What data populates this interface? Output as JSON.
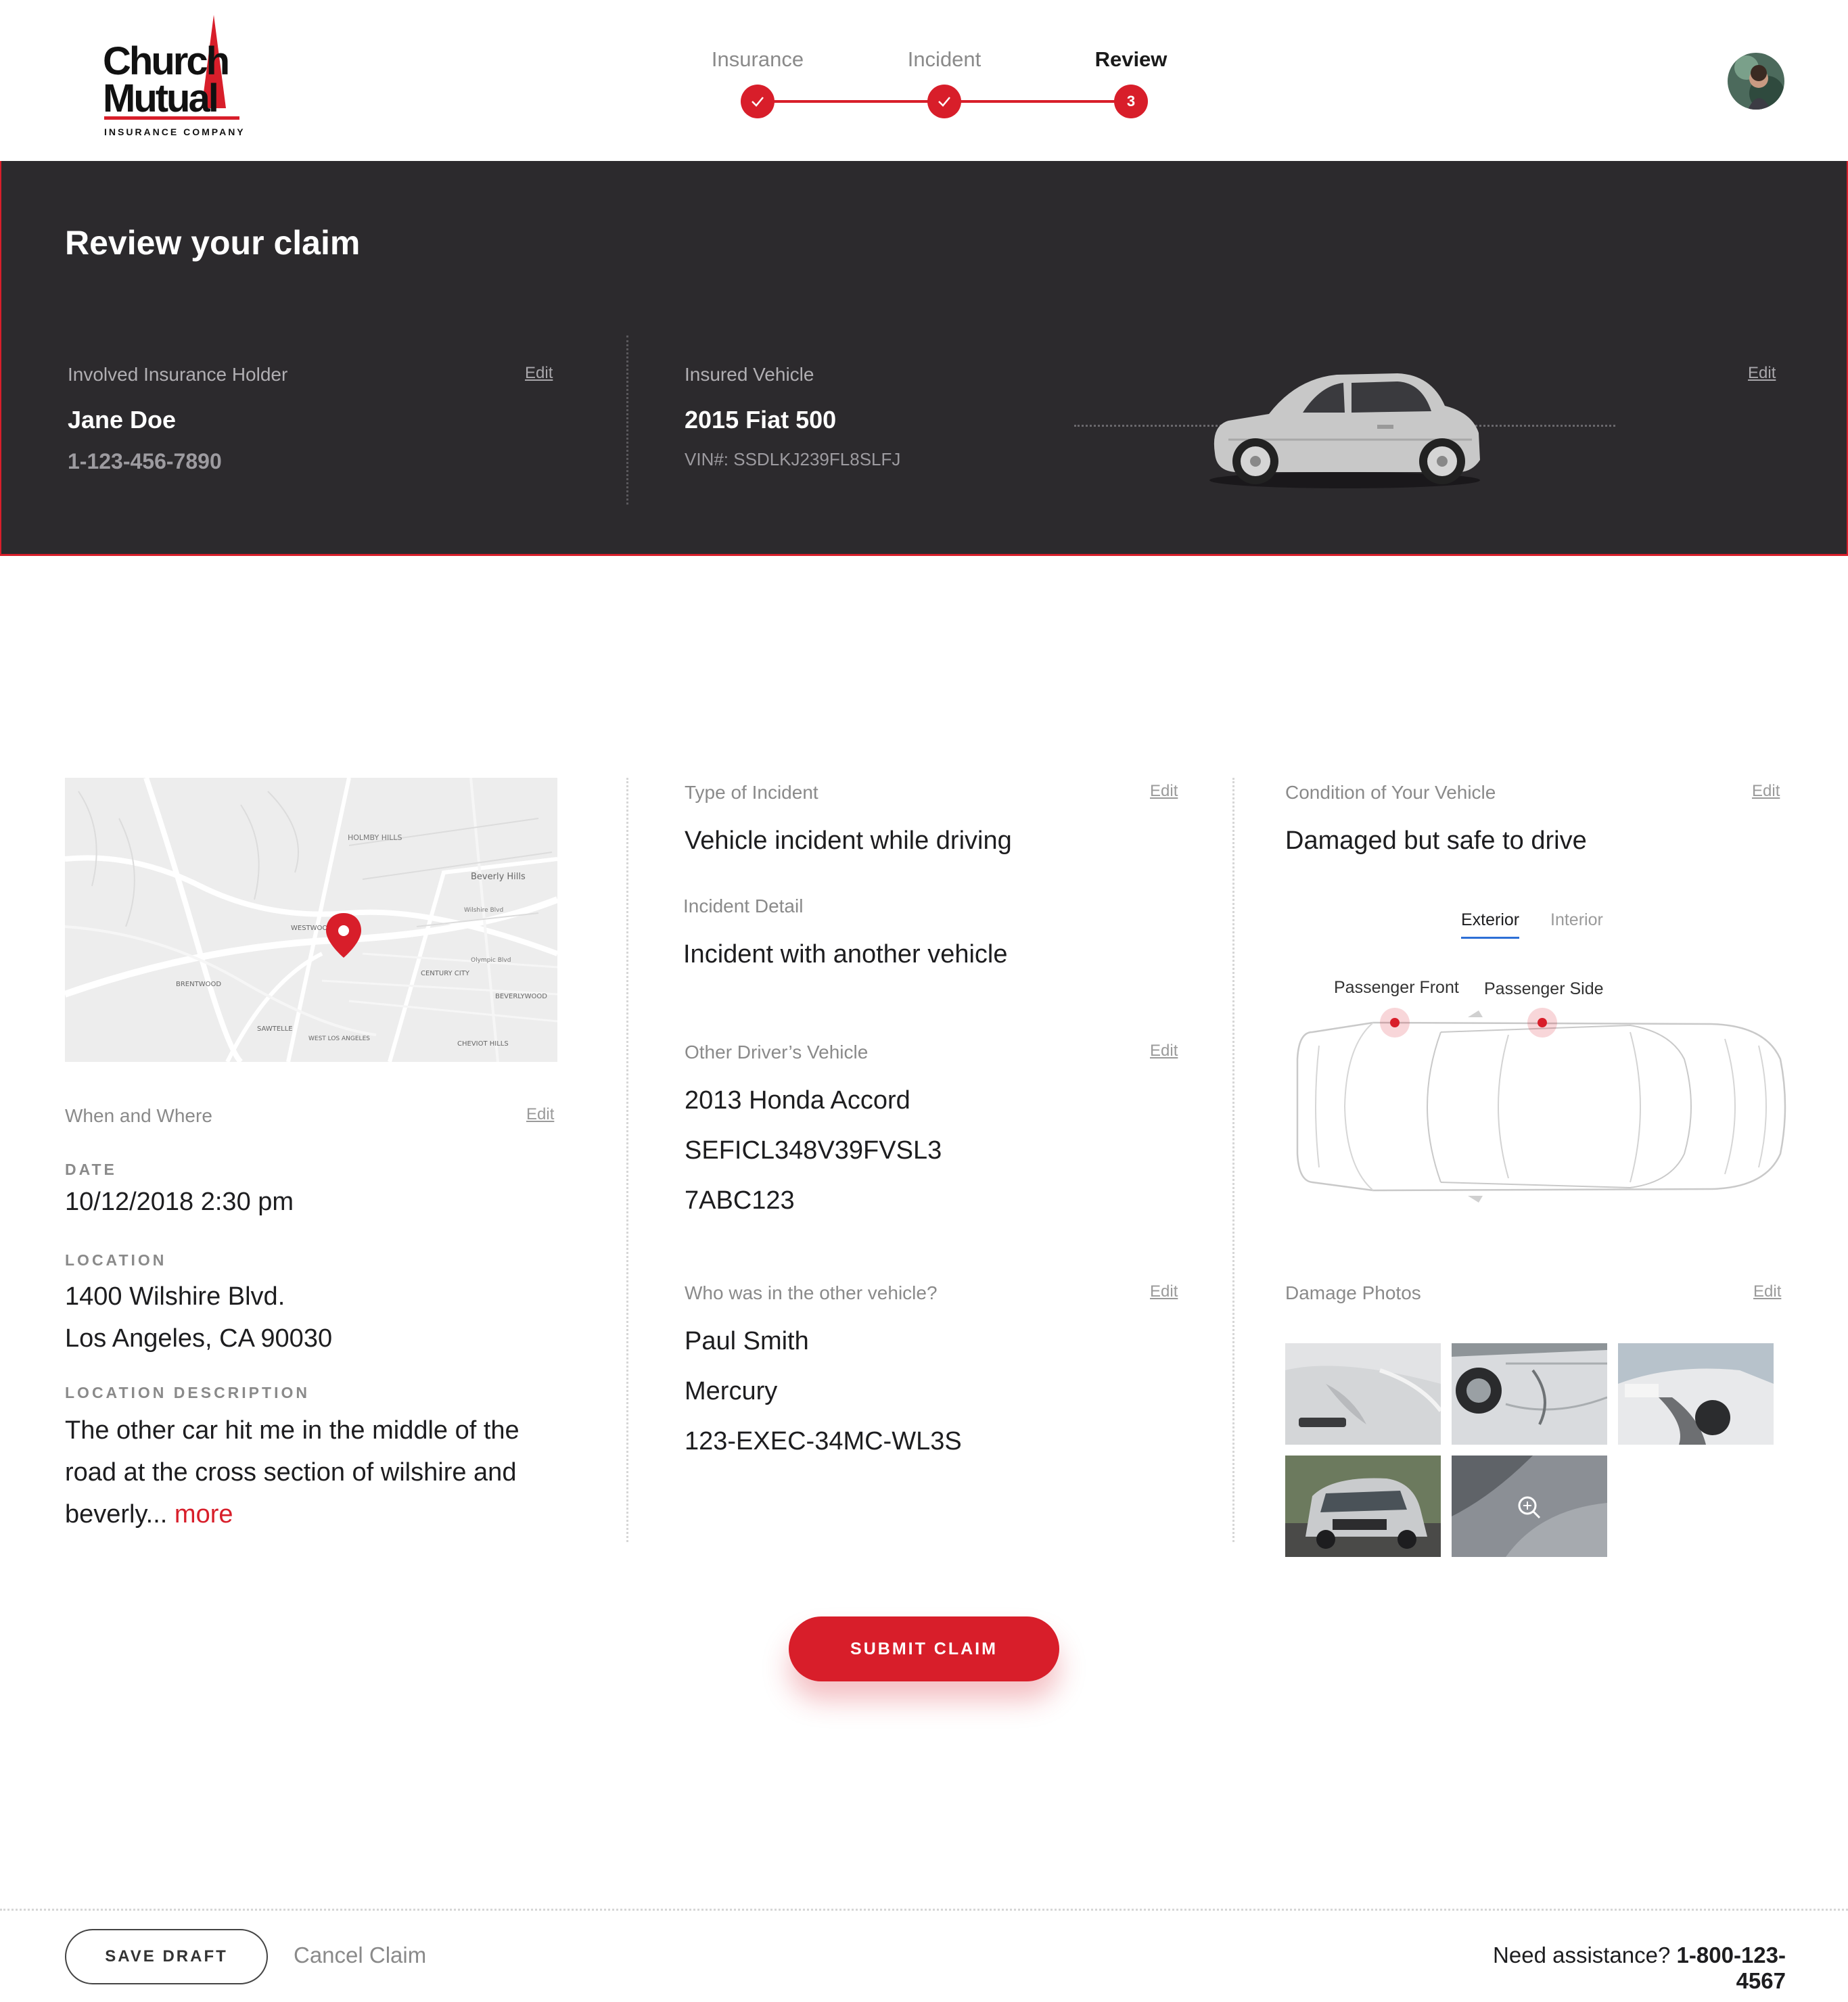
{
  "brand": {
    "logo_line1": "Church",
    "logo_line2": "Mutual",
    "logo_sub": "INSURANCE COMPANY",
    "accent": "#d81e2a",
    "dark_bg": "#2c2a2d"
  },
  "stepper": {
    "steps": [
      {
        "label": "Insurance",
        "state": "done"
      },
      {
        "label": "Incident",
        "state": "done"
      },
      {
        "label": "Review",
        "state": "current",
        "number": "3"
      }
    ]
  },
  "banner": {
    "title": "Review your claim",
    "holder": {
      "label": "Involved Insurance Holder",
      "edit": "Edit",
      "name": "Jane Doe",
      "phone": "1-123-456-7890"
    },
    "vehicle": {
      "label": "Insured Vehicle",
      "edit": "Edit",
      "name": "2015 Fiat 500",
      "vin": "VIN#: SSDLKJ239FL8SLFJ"
    }
  },
  "when_where": {
    "label": "When and Where",
    "edit": "Edit",
    "date_caption": "DATE",
    "date": "10/12/2018 2:30 pm",
    "location_caption": "LOCATION",
    "location_line1": "1400 Wilshire Blvd.",
    "location_line2": "Los Angeles, CA 90030",
    "desc_caption": "LOCATION DESCRIPTION",
    "desc_line1": "The other car hit me in the middle of the",
    "desc_line2": "road at the cross section of wilshire and",
    "desc_line3": "beverly...",
    "more": "more"
  },
  "map": {
    "labels": [
      "HOLMBY HILLS",
      "Beverly Hills",
      "WESTWOOD",
      "BRENTWOOD",
      "CENTURY CITY",
      "BEVERLYWOOD",
      "SAWTELLE",
      "WEST LOS ANGELES",
      "CHEVIOT HILLS",
      "Wilshire Blvd",
      "Olympic Blvd"
    ]
  },
  "incident": {
    "type_label": "Type of Incident",
    "type_edit": "Edit",
    "type_value": "Vehicle incident while driving",
    "detail_label": "Incident Detail",
    "detail_value": "Incident with another vehicle",
    "other_vehicle_label": "Other Driver’s Vehicle",
    "other_vehicle_edit": "Edit",
    "other_vehicle_name": "2013 Honda Accord",
    "other_vehicle_vin": "SEFICL348V39FVSL3",
    "other_vehicle_plate": "7ABC123",
    "who_label": "Who was in the other vehicle?",
    "who_edit": "Edit",
    "who_name": "Paul Smith",
    "who_insurer": "Mercury",
    "who_policy": "123-EXEC-34MC-WL3S"
  },
  "condition": {
    "label": "Condition of Your Vehicle",
    "edit": "Edit",
    "value": "Damaged but safe to drive",
    "tabs": [
      {
        "label": "Exterior",
        "active": true
      },
      {
        "label": "Interior",
        "active": false
      }
    ],
    "hotspots": [
      "Passenger Front",
      "Passenger Side"
    ],
    "photos_label": "Damage Photos",
    "photos_edit": "Edit",
    "photo_count": 5
  },
  "actions": {
    "submit": "SUBMIT CLAIM",
    "save_draft": "SAVE DRAFT",
    "cancel": "Cancel Claim",
    "assist_text": "Need assistance?",
    "assist_phone": "1-800-123-4567"
  }
}
